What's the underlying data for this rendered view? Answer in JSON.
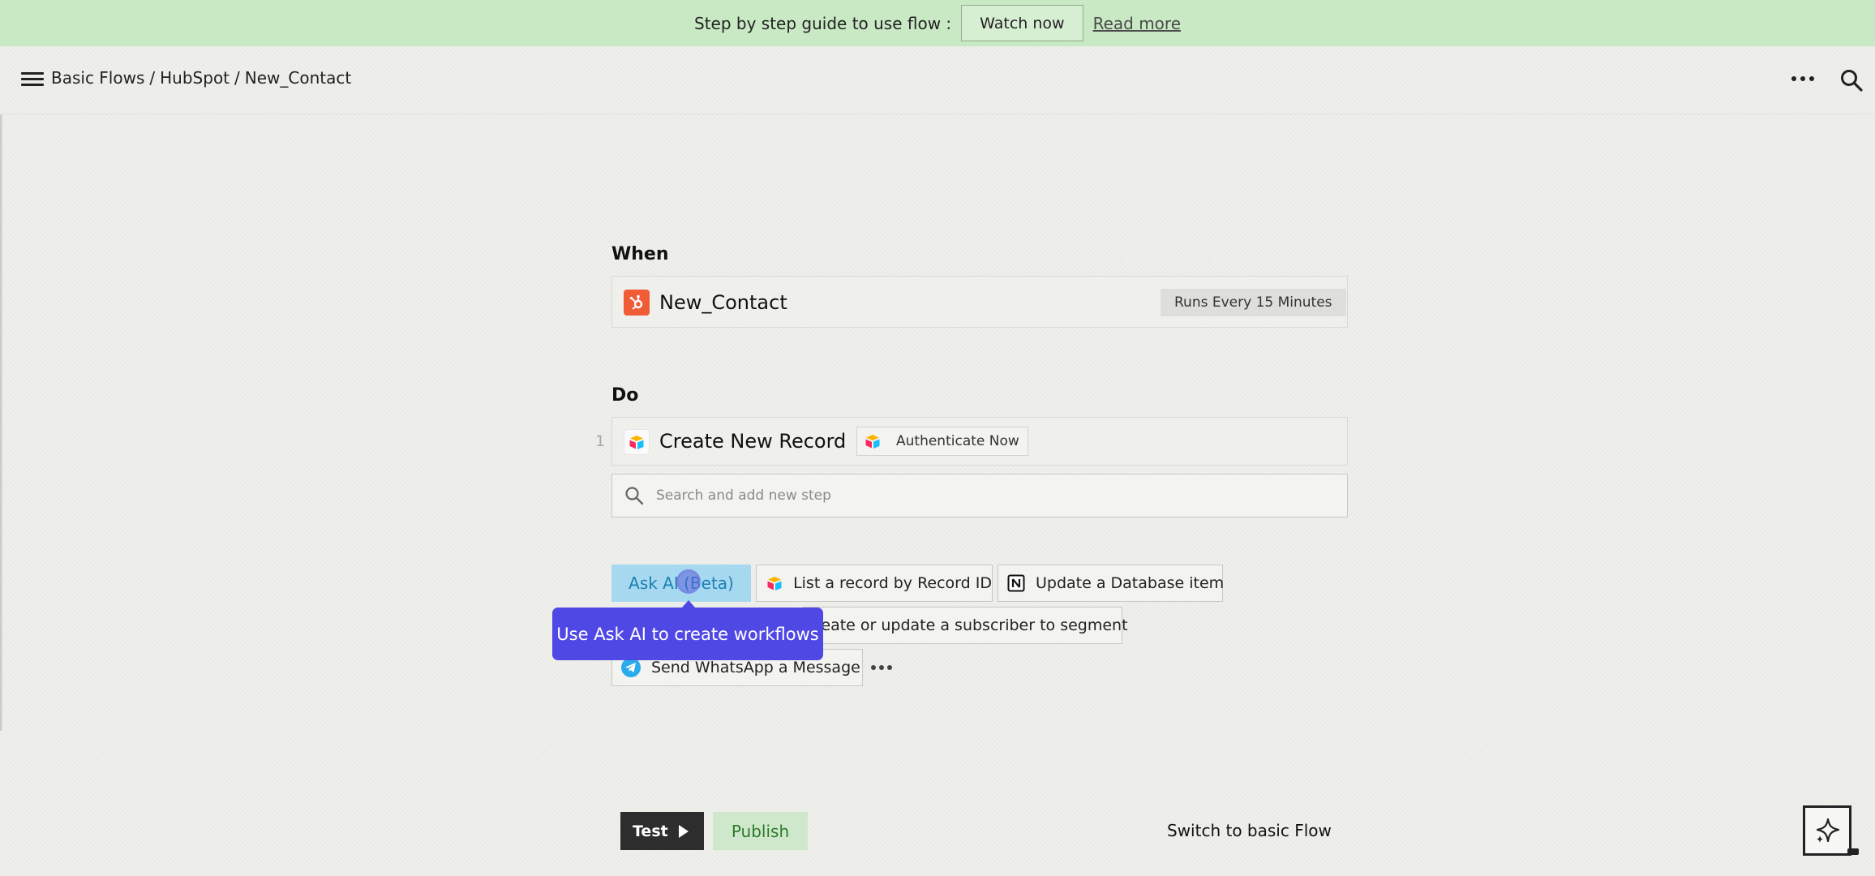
{
  "banner": {
    "guide_text": "Step by step guide to use flow :",
    "watch_label": "Watch now",
    "read_more_label": "Read more"
  },
  "header": {
    "breadcrumb": [
      "Basic Flows",
      "HubSpot",
      "New_Contact"
    ],
    "separator": "/",
    "icons": [
      "menu-icon",
      "more-icon",
      "search-icon"
    ]
  },
  "when": {
    "title": "When",
    "trigger": {
      "app_icon": "hubspot-icon",
      "name": "New_Contact",
      "schedule": "Runs Every 15 Minutes"
    }
  },
  "do": {
    "title": "Do",
    "steps": [
      {
        "number": "1",
        "app_icon": "airtable-icon",
        "name": "Create New Record",
        "auth_label": "Authenticate Now"
      }
    ],
    "search_placeholder": "Search and add new step"
  },
  "suggestions": {
    "ask_ai_label": "Ask AI (Beta)",
    "tooltip": "Use Ask AI to create workflows",
    "items": [
      {
        "label": "List a record by Record ID",
        "icon": "airtable-icon"
      },
      {
        "label": "Update a Database item",
        "icon": "notion-icon"
      },
      {
        "label": "reate or update a subscriber to segment",
        "icon": ""
      },
      {
        "label": "Send WhatsApp a Message",
        "icon": "telegram-icon"
      }
    ],
    "more_icon": "more-icon"
  },
  "footer": {
    "test_label": "Test",
    "publish_label": "Publish",
    "switch_label": "Switch to basic Flow",
    "ai_button_icon": "sparkle-icon"
  },
  "colors": {
    "banner_bg": "#c9e9c4",
    "hubspot": "#ef5c36",
    "ask_ai_bg": "#a6d9ef",
    "tooltip_bg": "#5048e5",
    "publish_bg": "#cfe8cb"
  }
}
